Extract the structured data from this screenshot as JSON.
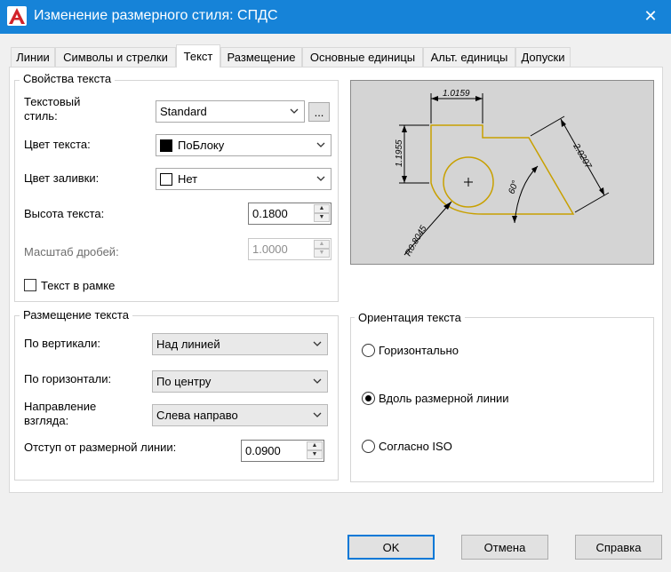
{
  "window": {
    "title": "Изменение размерного стиля: СПДС",
    "close_glyph": "✕",
    "app_icon": "autocad-a-icon"
  },
  "tabs": [
    {
      "label": "Линии",
      "active": false
    },
    {
      "label": "Символы и стрелки",
      "active": false
    },
    {
      "label": "Текст",
      "active": true
    },
    {
      "label": "Размещение",
      "active": false
    },
    {
      "label": "Основные единицы",
      "active": false
    },
    {
      "label": "Альт. единицы",
      "active": false
    },
    {
      "label": "Допуски",
      "active": false
    }
  ],
  "text_props": {
    "legend": "Свойства текста",
    "style_label_1": "Текстовый",
    "style_label_2": "стиль:",
    "style_value": "Standard",
    "style_more": "...",
    "color_label": "Цвет текста:",
    "color_value": "ПоБлоку",
    "color_swatch": "#000000",
    "fill_label": "Цвет заливки:",
    "fill_value": "Нет",
    "fill_swatch": "#ffffff",
    "height_label": "Высота текста:",
    "height_value": "0.1800",
    "fraction_label": "Масштаб дробей:",
    "fraction_value": "1.0000",
    "frame_label": "Текст в рамке",
    "frame_checked": false
  },
  "placement": {
    "legend": "Размещение текста",
    "vertical_label": "По вертикали:",
    "vertical_value": "Над линией",
    "horizontal_label": "По горизонтали:",
    "horizontal_value": "По центру",
    "direction_label_1": "Направление",
    "direction_label_2": "взгляда:",
    "direction_value": "Слева направо",
    "offset_label": "Отступ от размерной линии:",
    "offset_value": "0.0900"
  },
  "orientation": {
    "legend": "Ориентация текста",
    "options": [
      {
        "label": "Горизонтально",
        "selected": false
      },
      {
        "label": "Вдоль размерной линии",
        "selected": true
      },
      {
        "label": "Согласно ISO",
        "selected": false
      }
    ]
  },
  "preview": {
    "dims": {
      "top": "1.0159",
      "left": "1.1955",
      "right": "2.0207",
      "angle": "60°",
      "radius": "R0.8045"
    },
    "colors": {
      "background": "#d4d4d4",
      "geometry": "#c8a000",
      "dimension": "#000000"
    }
  },
  "buttons": {
    "ok": "OK",
    "cancel": "Отмена",
    "help": "Справка"
  },
  "colors": {
    "titlebar": "#1683d8",
    "accent": "#0078d7",
    "logo_red": "#d2232a"
  }
}
